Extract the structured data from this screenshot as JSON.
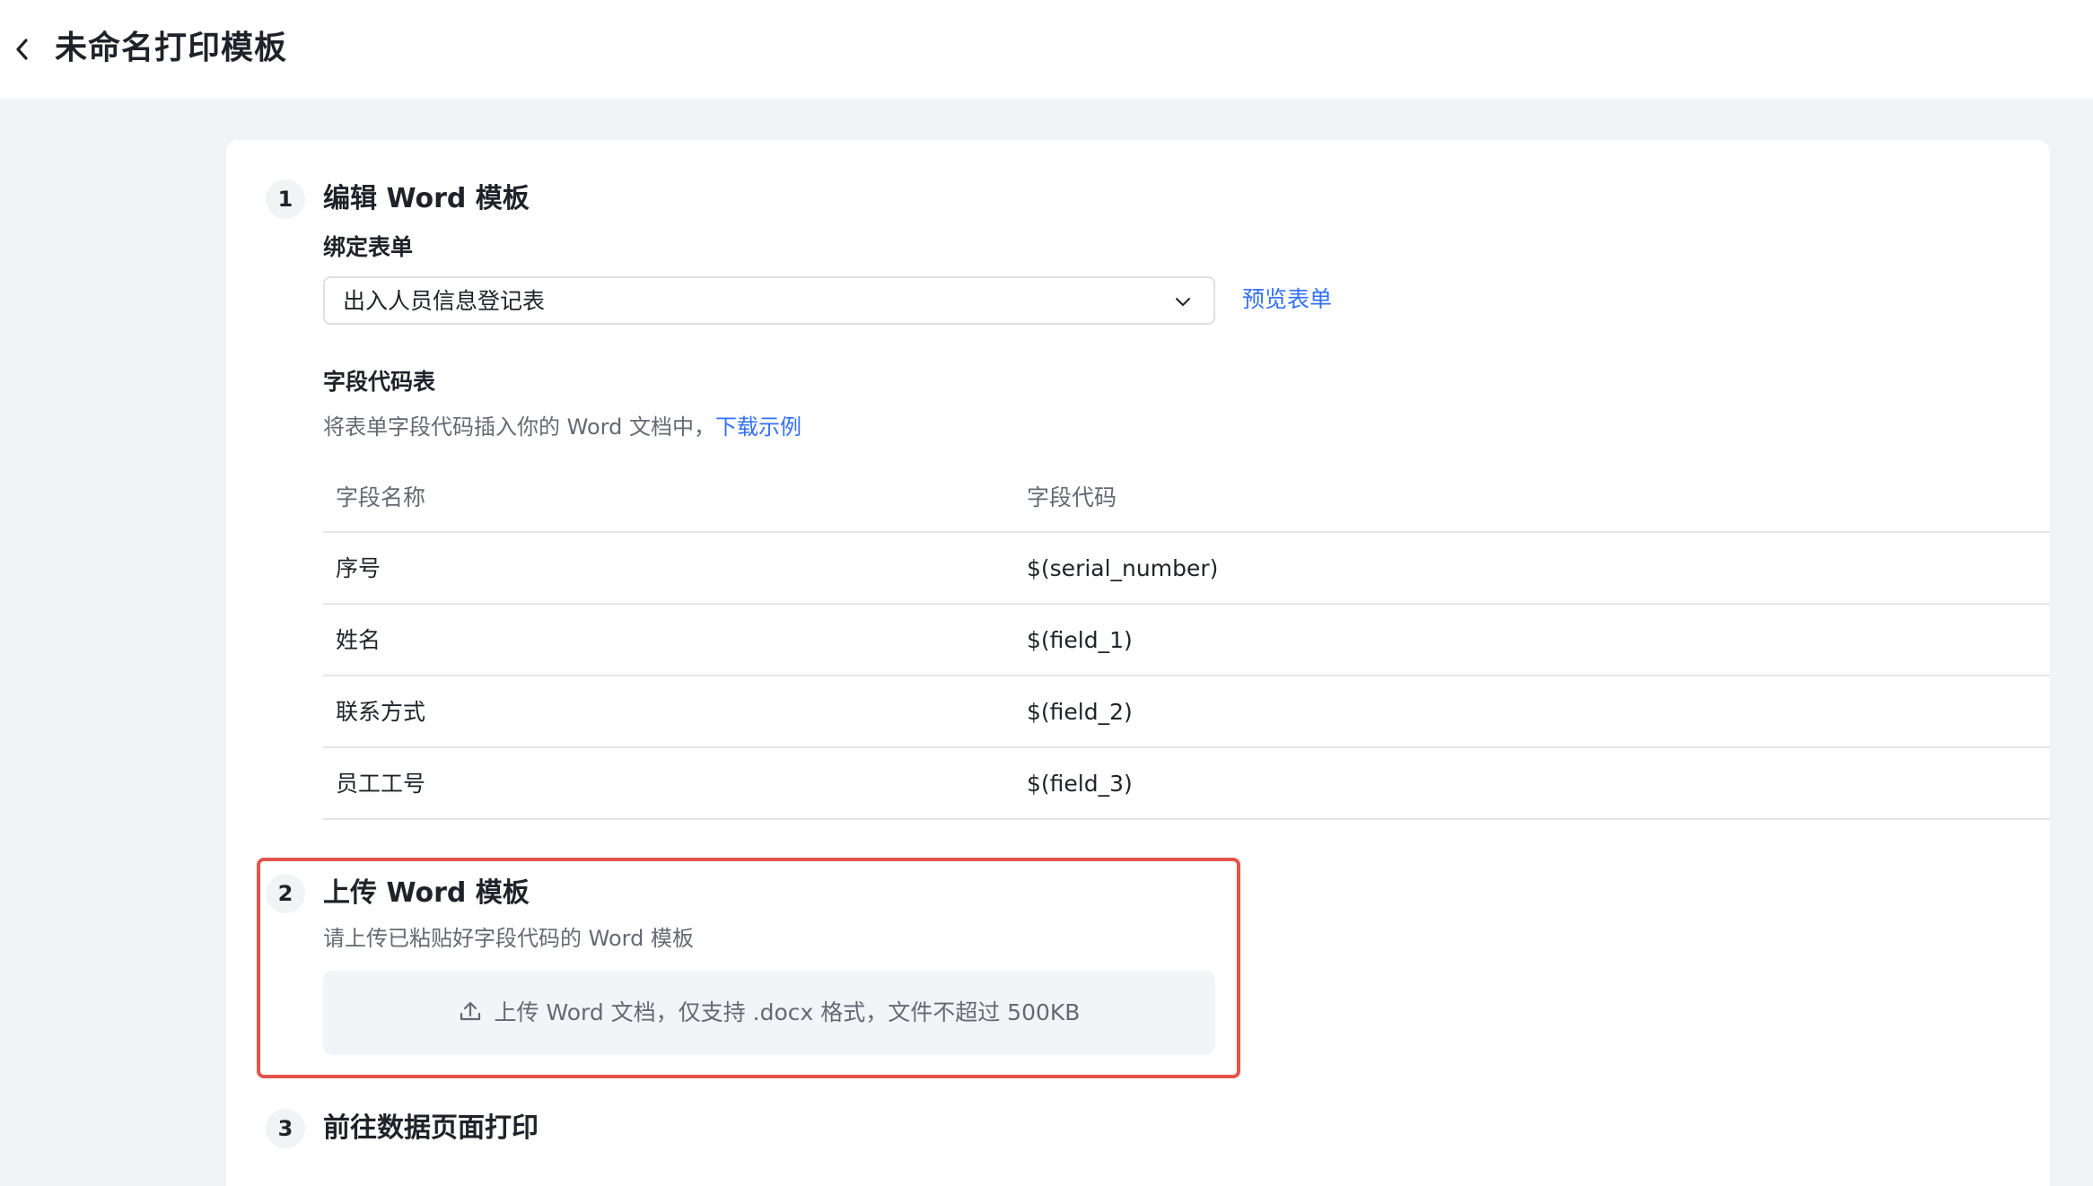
{
  "header": {
    "title": "未命名打印模板"
  },
  "steps": [
    {
      "number": "1",
      "title": "编辑 Word 模板",
      "bind_form_label": "绑定表单",
      "selected_form": "出入人员信息登记表",
      "preview_link": "预览表单",
      "field_table_label": "字段代码表",
      "field_table_hint": "将表单字段代码插入你的 Word 文档中，",
      "download_link": "下载示例"
    },
    {
      "number": "2",
      "title": "上传 Word 模板",
      "hint": "请上传已粘贴好字段代码的 Word 模板",
      "upload_text": "上传 Word 文档，仅支持 .docx 格式，文件不超过 500KB"
    },
    {
      "number": "3",
      "title": "前往数据页面打印"
    }
  ],
  "field_table": {
    "columns": [
      "字段名称",
      "字段代码"
    ],
    "rows": [
      [
        "序号",
        "$(serial_number)"
      ],
      [
        "姓名",
        "$(field_1)"
      ],
      [
        "联系方式",
        "$(field_2)"
      ],
      [
        "员工工号",
        "$(field_3)"
      ]
    ]
  },
  "colors": {
    "accent": "#3370ff",
    "highlight": "#e5534b",
    "background": "#f2f3f5"
  },
  "icons": [
    "chevron-left-icon",
    "chevron-down-icon",
    "upload-icon"
  ]
}
